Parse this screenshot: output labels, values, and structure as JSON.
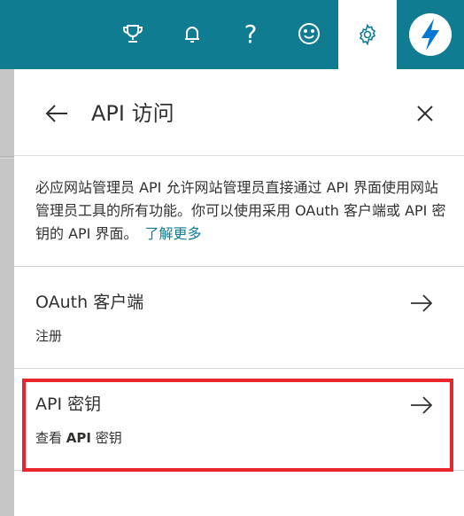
{
  "topbar": {
    "icons": [
      "trophy-icon",
      "bell-icon",
      "help-icon",
      "smiley-icon",
      "gear-icon",
      "brand-bolt-icon"
    ],
    "help_glyph": "?"
  },
  "panel": {
    "title": "API 访问",
    "description": "必应网站管理员 API 允许网站管理员直接通过 API 界面使用网站管理员工具的所有功能。你可以使用采用 OAuth 客户端或 API 密钥的 API 界面。",
    "learn_more": "了解更多"
  },
  "options": [
    {
      "title": "OAuth 客户端",
      "subtitle": "注册"
    },
    {
      "title": "API 密钥",
      "subtitle_prefix": "查看 ",
      "subtitle_bold": "API",
      "subtitle_suffix": " 密钥"
    }
  ],
  "colors": {
    "accent": "#0f7c92",
    "highlight": "#e8262e"
  }
}
